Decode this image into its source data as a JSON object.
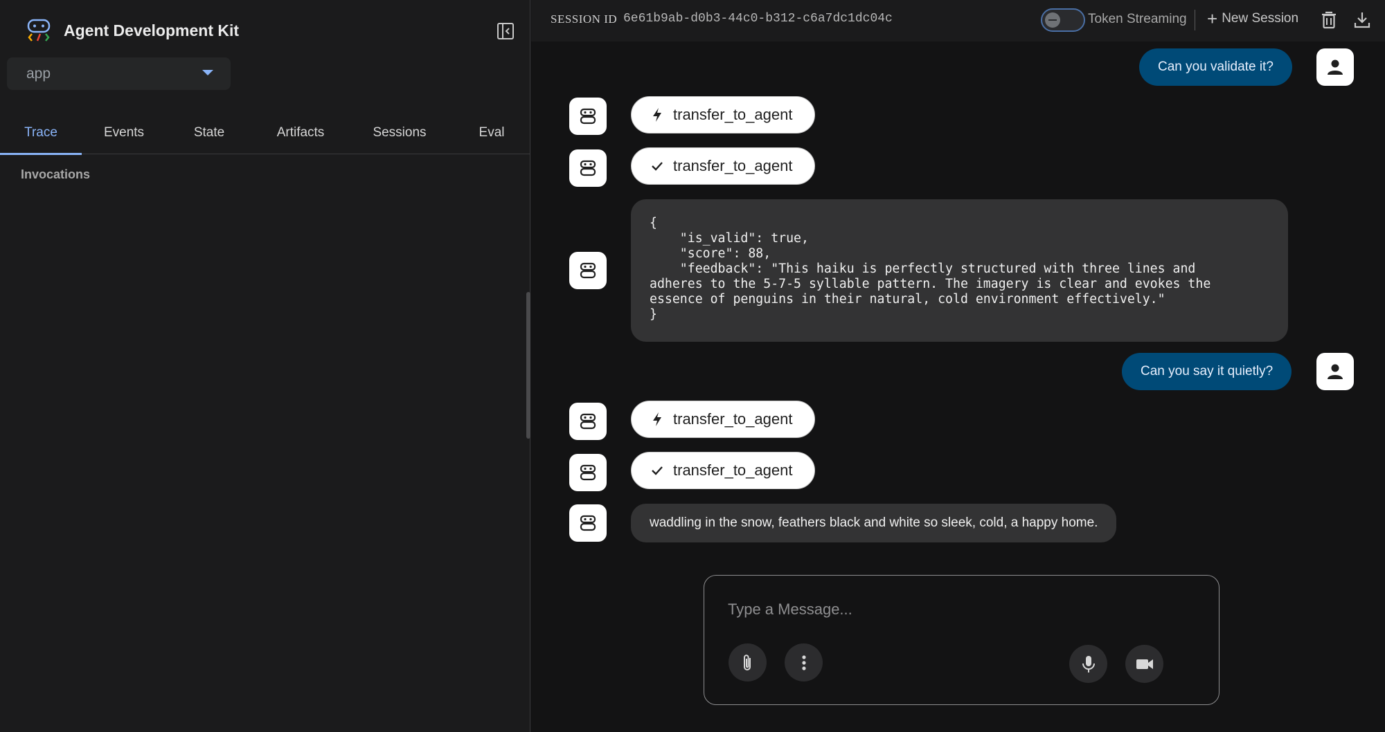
{
  "app": {
    "title": "Agent Development Kit",
    "selected_app": "app"
  },
  "sidebar": {
    "tabs": [
      {
        "label": "Trace",
        "active": true
      },
      {
        "label": "Events",
        "active": false
      },
      {
        "label": "State",
        "active": false
      },
      {
        "label": "Artifacts",
        "active": false
      },
      {
        "label": "Sessions",
        "active": false
      },
      {
        "label": "Eval",
        "active": false
      }
    ],
    "section_title": "Invocations"
  },
  "topbar": {
    "session_label": "SESSION ID",
    "session_id": "6e61b9ab-d0b3-44c0-b312-c6a7dc1dc04c",
    "token_streaming_label": "Token Streaming",
    "token_streaming_on": false,
    "new_session_label": "New Session"
  },
  "chat": {
    "user_message_1": "Can you validate it?",
    "call_1": "transfer_to_agent",
    "result_1": "transfer_to_agent",
    "code_response": "{\n    \"is_valid\": true,\n    \"score\": 88,\n    \"feedback\": \"This haiku is perfectly structured with three lines and\nadheres to the 5-7-5 syllable pattern. The imagery is clear and evokes the\nessence of penguins in their natural, cold environment effectively.\"\n}",
    "user_message_2": "Can you say it quietly?",
    "call_2": "transfer_to_agent",
    "result_2": "transfer_to_agent",
    "agent_reply": "waddling in the snow, feathers black and white so sleek, cold, a happy home."
  },
  "composer": {
    "placeholder": "Type a Message..."
  },
  "icons": {
    "call": "bolt-icon",
    "result": "check-icon",
    "agent": "robot-icon",
    "user": "person-icon"
  },
  "colors": {
    "accent": "#8ab4f8",
    "user_bubble": "#004a77",
    "agent_bubble": "#333334",
    "background": "#131314"
  }
}
